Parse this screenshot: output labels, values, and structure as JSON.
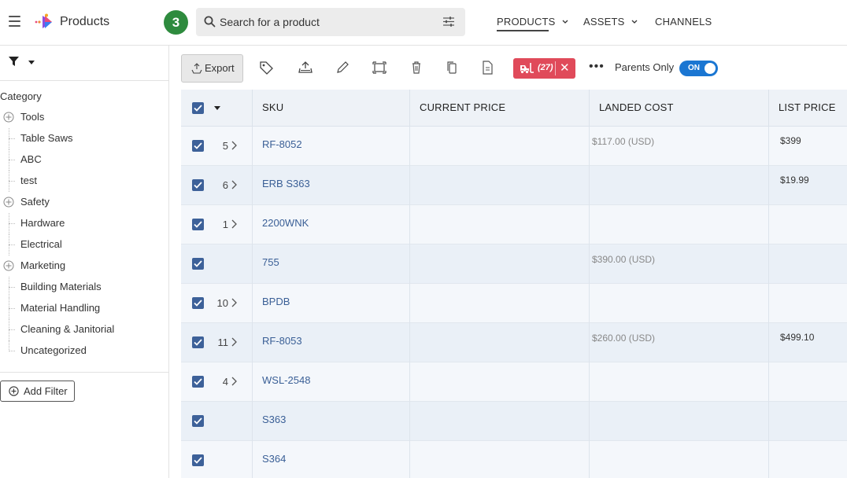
{
  "header": {
    "app_title": "Products",
    "step_badge": "3",
    "search": {
      "placeholder": "Search for a product",
      "value": ""
    },
    "nav": [
      {
        "label": "PRODUCTS",
        "active": true
      },
      {
        "label": "ASSETS",
        "active": false
      },
      {
        "label": "CHANNELS",
        "active": false
      }
    ],
    "icons": {
      "menu": "hamburger-icon",
      "logo": "brand-logo",
      "search": "search-icon",
      "search_options": "tune-icon",
      "dropdown": "chevron-down-icon"
    }
  },
  "sidebar": {
    "category_label": "Category",
    "tree": [
      {
        "label": "Tools",
        "expandable": true
      },
      {
        "label": "Table Saws",
        "expandable": false
      },
      {
        "label": "ABC",
        "expandable": false
      },
      {
        "label": "test",
        "expandable": false
      },
      {
        "label": "Safety",
        "expandable": true
      },
      {
        "label": "Hardware",
        "expandable": false
      },
      {
        "label": "Electrical",
        "expandable": false
      },
      {
        "label": "Marketing",
        "expandable": true
      },
      {
        "label": "Building Materials",
        "expandable": false
      },
      {
        "label": "Material Handling",
        "expandable": false
      },
      {
        "label": "Cleaning & Janitorial",
        "expandable": false
      },
      {
        "label": "Uncategorized",
        "expandable": false
      }
    ],
    "add_filter_label": "Add Filter"
  },
  "toolbar": {
    "export_label": "Export",
    "icons": [
      "tag-icon",
      "upload-icon",
      "edit-icon",
      "crop-icon",
      "trash-icon",
      "copy-icon",
      "document-icon"
    ],
    "filter_chip": {
      "icon": "forklift-icon",
      "count": "(27)",
      "close": "✕"
    },
    "more": "•••",
    "parents_only_label": "Parents Only",
    "toggle_label": "ON",
    "toggle_on": true
  },
  "table": {
    "columns": [
      "SKU",
      "CURRENT PRICE",
      "LANDED COST",
      "LIST PRICE"
    ],
    "rows": [
      {
        "checked": true,
        "children": "5",
        "expandable": true,
        "sku": "RF-8052",
        "current_price": "",
        "landed_cost": "$117.00 (USD)",
        "list_price": "$399"
      },
      {
        "checked": true,
        "children": "6",
        "expandable": true,
        "sku": "ERB S363",
        "current_price": "",
        "landed_cost": "",
        "list_price": "$19.99"
      },
      {
        "checked": true,
        "children": "1",
        "expandable": true,
        "sku": "2200WNK",
        "current_price": "",
        "landed_cost": "",
        "list_price": ""
      },
      {
        "checked": true,
        "children": "",
        "expandable": false,
        "sku": "755",
        "current_price": "",
        "landed_cost": "$390.00 (USD)",
        "list_price": ""
      },
      {
        "checked": true,
        "children": "10",
        "expandable": true,
        "sku": "BPDB",
        "current_price": "",
        "landed_cost": "",
        "list_price": ""
      },
      {
        "checked": true,
        "children": "11",
        "expandable": true,
        "sku": "RF-8053",
        "current_price": "",
        "landed_cost": "$260.00 (USD)",
        "list_price": "$499.10"
      },
      {
        "checked": true,
        "children": "4",
        "expandable": true,
        "sku": "WSL-2548",
        "current_price": "",
        "landed_cost": "",
        "list_price": ""
      },
      {
        "checked": true,
        "children": "",
        "expandable": false,
        "sku": "S363",
        "current_price": "",
        "landed_cost": "",
        "list_price": ""
      },
      {
        "checked": true,
        "children": "",
        "expandable": false,
        "sku": "S364",
        "current_price": "",
        "landed_cost": "",
        "list_price": ""
      }
    ]
  },
  "colors": {
    "accent": "#1a76d2",
    "checkbox": "#3d6199",
    "chip": "#e04a5a",
    "badge": "#2e8b3e",
    "sku_link": "#3a5f96"
  }
}
